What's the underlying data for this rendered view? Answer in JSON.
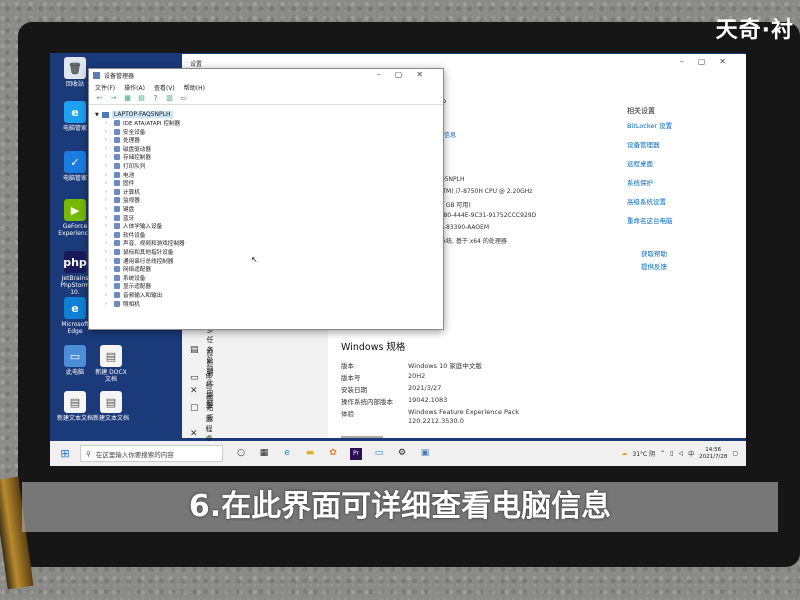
{
  "watermark": "天奇·衬",
  "caption": "6.在此界面可详细查看电脑信息",
  "desktop_icons": [
    {
      "name": "recycle-bin",
      "label": "回收站",
      "glyph": "🗑",
      "color": "#dfe6ef"
    },
    {
      "name": "edge-legacy",
      "label": "电脑管家",
      "glyph": "e",
      "color": "#1ea1f1"
    },
    {
      "name": "tencent-pc-manager",
      "label": "电脑管家",
      "glyph": "✓",
      "color": "#1b7ce0"
    },
    {
      "name": "geforce",
      "label": "GeForce Experience",
      "glyph": "▶",
      "color": "#76b900"
    },
    {
      "name": "phpstudy",
      "label": "JetBrains PhpStorm 10.",
      "glyph": "php",
      "color": "#1a1a5a"
    },
    {
      "name": "microsoft-edge",
      "label": "Microsoft Edge",
      "glyph": "e",
      "color": "#0f7fd4"
    },
    {
      "name": "this-pc",
      "label": "此电脑",
      "glyph": "▭",
      "color": "#4a8fd8"
    },
    {
      "name": "doc-1",
      "label": "新建 DOCX 文档",
      "glyph": "▤",
      "color": "#f5f5f5"
    },
    {
      "name": "doc-2",
      "label": "新建文本文档",
      "glyph": "▤",
      "color": "#f5f5f5"
    },
    {
      "name": "doc-3",
      "label": "新建文本文档",
      "glyph": "▤",
      "color": "#f5f5f5"
    }
  ],
  "settings": {
    "title": "设置",
    "heading_partial": "电脑。",
    "link_partial": "信息",
    "device_lines": [
      "Q5NPLH",
      "(TM) i7-8750H CPU @ 2.20GHz",
      "6 GB 可用)",
      "F80-444E-9C31-91752CCC929D",
      "0-83390-AAOEM",
      "系统, 基于 x64 的处理器"
    ],
    "related_title": "相关设置",
    "related_links": [
      "BitLocker 设置",
      "设备管理器",
      "远程桌面",
      "系统保护",
      "高级系统设置",
      "重命名这台电脑"
    ],
    "help_links": [
      "获取帮助",
      "提供反馈"
    ],
    "nav_items": [
      {
        "name": "multitask",
        "icon": "▤",
        "label": "多任务处理"
      },
      {
        "name": "project",
        "icon": "▭",
        "label": "投影到此电脑"
      },
      {
        "name": "shared",
        "icon": "✕",
        "label": "体验共享"
      },
      {
        "name": "clipboard",
        "icon": "▢",
        "label": "剪贴板"
      },
      {
        "name": "remote",
        "icon": "✕",
        "label": "远程桌面"
      }
    ],
    "spec_heading": "Windows 规格",
    "specs": [
      {
        "label": "版本",
        "value": "Windows 10 家庭中文版"
      },
      {
        "label": "版本号",
        "value": "20H2"
      },
      {
        "label": "安装日期",
        "value": "2021/3/27"
      },
      {
        "label": "操作系统内部版本",
        "value": "19042.1083"
      },
      {
        "label": "体验",
        "value": "Windows Feature Experience Pack"
      },
      {
        "label": "",
        "value": "120.2212.3530.0"
      }
    ]
  },
  "device_manager": {
    "title": "设备管理器",
    "menu": [
      "文件(F)",
      "操作(A)",
      "查看(V)",
      "帮助(H)"
    ],
    "root": "LAPTOP-FAQ5NPLH",
    "items": [
      "IDE ATA/ATAPI 控制器",
      "安全设备",
      "处理器",
      "磁盘驱动器",
      "存储控制器",
      "打印队列",
      "电池",
      "固件",
      "计算机",
      "监视器",
      "键盘",
      "蓝牙",
      "人体学输入设备",
      "软件设备",
      "声音、视频和游戏控制器",
      "鼠标和其他指针设备",
      "通用串行总线控制器",
      "网络适配器",
      "系统设备",
      "显示适配器",
      "音频输入和输出",
      "照相机"
    ]
  },
  "taskbar": {
    "search_placeholder": "在这里输入你要搜索的内容",
    "weather": "31°C 阴",
    "ime": "中",
    "time": "14:56",
    "date": "2021/7/28"
  }
}
